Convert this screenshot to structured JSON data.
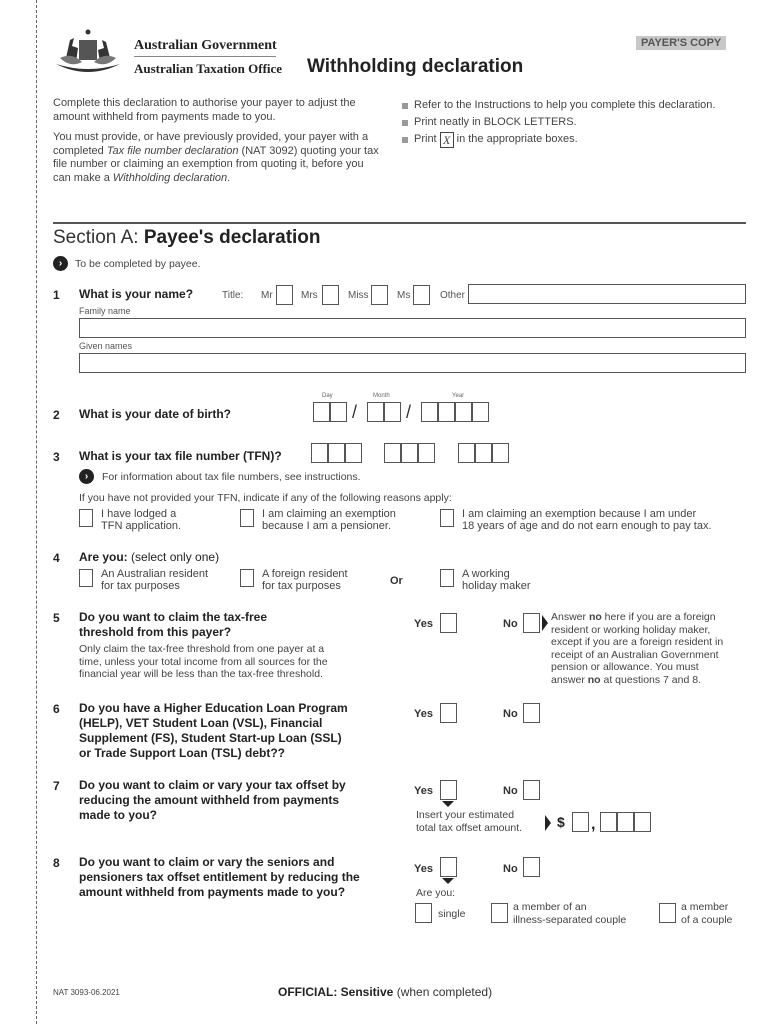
{
  "header": {
    "gov_name": "Australian Government",
    "agency": "Australian Taxation Office",
    "title": "Withholding declaration",
    "copy_badge": "PAYER'S COPY"
  },
  "intro": {
    "p1": "Complete this declaration to authorise your payer to adjust the amount withheld from payments made to you.",
    "p2_a": "You must provide, or have previously provided, your payer with a completed ",
    "p2_em1": "Tax file number declaration",
    "p2_b": " (NAT 3092) quoting your tax file number or claiming an exemption from quoting it, before you can make a ",
    "p2_em2": "Withholding declaration",
    "p2_c": "."
  },
  "bullets": {
    "b1": "Refer to the Instructions to help you complete this declaration.",
    "b2": "Print neatly in BLOCK LETTERS.",
    "b3_a": "Print",
    "b3_x": "X",
    "b3_b": "in the appropriate boxes."
  },
  "section": {
    "prefix": "Section A: ",
    "title": "Payee's declaration",
    "hint": "To be completed by payee."
  },
  "q1": {
    "num": "1",
    "text": "What is your name?",
    "title_label": "Title:",
    "titles": [
      "Mr",
      "Mrs",
      "Miss",
      "Ms",
      "Other"
    ],
    "family_label": "Family name",
    "family_value": "",
    "given_label": "Given names",
    "given_value": ""
  },
  "q2": {
    "num": "2",
    "text": "What is your date of birth?",
    "day": "Day",
    "month": "Month",
    "year": "Year",
    "sep": "/"
  },
  "q3": {
    "num": "3",
    "text": "What is your tax file number (TFN)?",
    "hint": "For information about tax file numbers, see instructions.",
    "reason_intro": "If you have not provided your TFN, indicate if any of the following reasons apply:",
    "r1a": "I have lodged a",
    "r1b": "TFN application.",
    "r2a": "I am claiming an exemption",
    "r2b": "because I am a pensioner.",
    "r3a": "I am claiming an exemption because I am under",
    "r3b": "18 years of age and do not earn enough to pay tax."
  },
  "q4": {
    "num": "4",
    "text": "Are you:",
    "sub": "(select only one)",
    "o1a": "An Australian resident",
    "o1b": "for tax purposes",
    "o2a": "A foreign resident",
    "o2b": "for tax purposes",
    "or": "Or",
    "o3a": "A working",
    "o3b": "holiday maker"
  },
  "q5": {
    "num": "5",
    "l1": "Do you want to claim the tax-free",
    "l2": "threshold from this payer?",
    "d1": "Only claim the tax-free threshold from one payer at a",
    "d2": "time, unless your total income from all sources for the",
    "d3": "financial year will be less than the tax-free threshold.",
    "yes": "Yes",
    "no": "No",
    "n1a": "Answer ",
    "n1b": "no",
    "n1c": " here if you are a foreign",
    "n2": "resident or working holiday maker,",
    "n3": "except if you are a foreign resident in",
    "n4": "receipt of an Australian Government",
    "n5": "pension or allowance. You must",
    "n6a": "answer ",
    "n6b": "no",
    "n6c": " at questions 7 and 8."
  },
  "q6": {
    "num": "6",
    "l1": "Do you have a Higher Education Loan Program",
    "l2": "(HELP), VET Student Loan (VSL), Financial",
    "l3": "Supplement (FS), Student Start-up Loan (SSL)",
    "l4": "or Trade Support Loan (TSL) debt??",
    "yes": "Yes",
    "no": "No"
  },
  "q7": {
    "num": "7",
    "l1": "Do you want to claim or vary your tax offset by",
    "l2": "reducing the amount withheld from payments",
    "l3": "made to you?",
    "yes": "Yes",
    "no": "No",
    "ins1": "Insert your estimated",
    "ins2": "total tax offset amount.",
    "currency": "$",
    "comma": ","
  },
  "q8": {
    "num": "8",
    "l1": "Do you want to claim or vary the seniors and",
    "l2": "pensioners tax offset entitlement by reducing the",
    "l3": "amount withheld from payments made to you?",
    "yes": "Yes",
    "no": "No",
    "are_you": "Are you:",
    "single": "single",
    "ill1": "a member of an",
    "ill2": "illness-separated couple",
    "cpl1": "a member",
    "cpl2": "of a couple"
  },
  "footer": {
    "code": "NAT 3093-06.2021",
    "class_bold": "OFFICIAL: Sensitive",
    "class_rest": " (when completed)"
  }
}
